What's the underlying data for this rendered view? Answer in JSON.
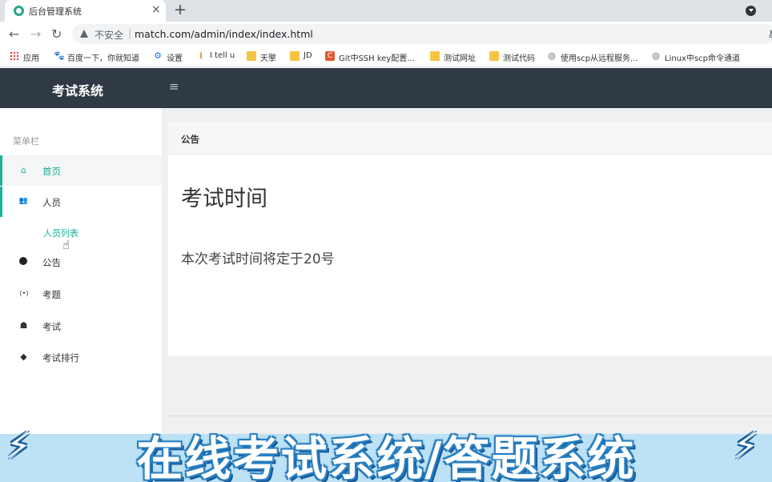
{
  "browser": {
    "tab_title": "后台管理系统",
    "tab_close_glyph": "×",
    "new_tab_glyph": "+",
    "back_glyph": "←",
    "forward_glyph": "→",
    "reload_glyph": "↻",
    "insecure_label": "不安全",
    "url": "match.com/admin/index/index.html",
    "bookmarks": [
      {
        "label": "应用",
        "icon": "apps-grid-icon"
      },
      {
        "label": "百度一下，你就知道",
        "icon": "baidu-paw-icon"
      },
      {
        "label": "设置",
        "icon": "gear-icon"
      },
      {
        "label": "I tell u",
        "icon": "itellyou-icon"
      },
      {
        "label": "天擎",
        "icon": "folder-icon"
      },
      {
        "label": "JD",
        "icon": "folder-icon"
      },
      {
        "label": "Git中SSH key配置...",
        "icon": "csdn-icon"
      },
      {
        "label": "测试网址",
        "icon": "folder-icon"
      },
      {
        "label": "测试代码",
        "icon": "folder-icon"
      },
      {
        "label": "使用scp从远程服务...",
        "icon": "globe-icon"
      },
      {
        "label": "Linux中scp命令通道",
        "icon": "globe-icon"
      }
    ]
  },
  "app": {
    "brand": "考试系统",
    "menu_toggle_glyph": "≡",
    "sidebar": {
      "title": "菜单栏",
      "items": [
        {
          "label": "首页",
          "icon": "home-icon",
          "glyph": "⌂"
        },
        {
          "label": "人员",
          "icon": "users-icon",
          "glyph": "👥"
        },
        {
          "label": "公告",
          "icon": "dot-icon",
          "glyph": ""
        },
        {
          "label": "考题",
          "icon": "broadcast-icon",
          "glyph": "(•)"
        },
        {
          "label": "考试",
          "icon": "shield-icon",
          "glyph": "☗"
        },
        {
          "label": "考试排行",
          "icon": "layers-icon",
          "glyph": "◆"
        }
      ],
      "sub_item": "人员列表"
    },
    "panel": {
      "header": "公告",
      "title": "考试时间",
      "body": "本次考试时间将定于20号"
    }
  },
  "overlay": {
    "banner_text": "在线考试系统/答题系统"
  },
  "colors": {
    "accent": "#1ab394",
    "topbar": "#2f3a45",
    "banner_bg": "#bde2f5",
    "banner_outline": "#2a7fc0"
  }
}
